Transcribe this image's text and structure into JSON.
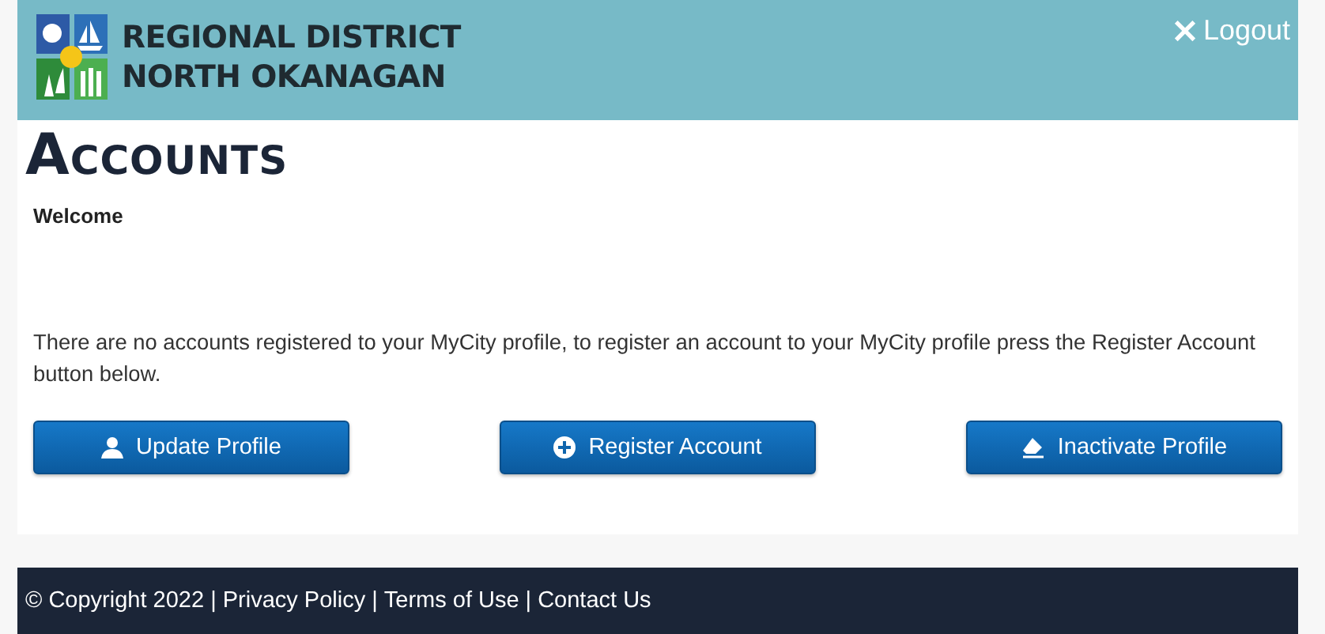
{
  "header": {
    "logo_lines": [
      "REGIONAL DISTRICT",
      "NORTH OKANAGAN"
    ],
    "logout": "Logout"
  },
  "page": {
    "title": "Accounts",
    "welcome": "Welcome",
    "message": "There are no accounts registered to your MyCity profile, to register an account to your MyCity profile press the Register Account button below."
  },
  "buttons": [
    {
      "label": "Update Profile",
      "kind": "user"
    },
    {
      "label": "Register Account",
      "kind": "plus"
    },
    {
      "label": "Inactivate Profile",
      "kind": "eraser"
    }
  ],
  "footer": {
    "copyright": "© Copyright 2022",
    "links": [
      {
        "separator": "|",
        "label": "Privacy Policy"
      },
      {
        "separator": "|",
        "label": "Terms of Use"
      },
      {
        "separator": "|",
        "label": "Contact Us"
      }
    ]
  }
}
